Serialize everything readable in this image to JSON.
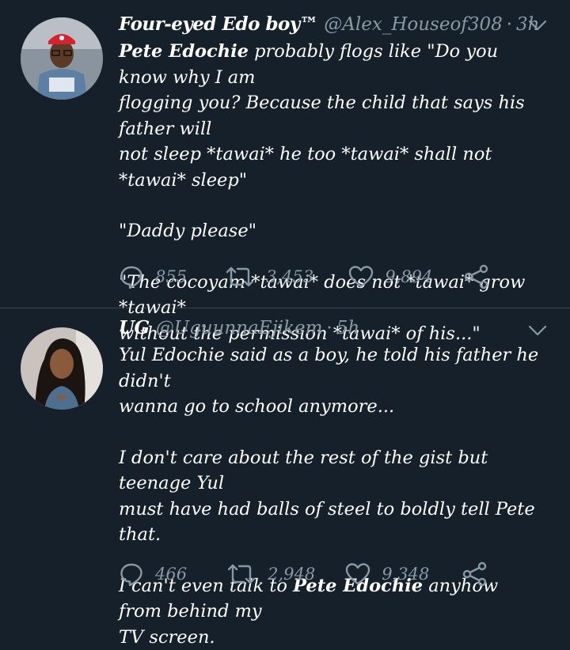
{
  "tweets": [
    {
      "name": "Four-eyed Edo boy™",
      "handle": "@Alex_Houseof308",
      "time": "3h",
      "lines": [
        [
          {
            "b": "Pete Edochie"
          },
          {
            "t": " probably flogs like \"Do you know why I am"
          }
        ],
        [
          {
            "t": "flogging you? Because the child that says his father will"
          }
        ],
        [
          {
            "t": "not sleep *tawai* he too *tawai* shall not *tawai* sleep\""
          }
        ],
        null,
        [
          {
            "t": "\"Daddy please\""
          }
        ],
        null,
        [
          {
            "t": "\"The cocoyam *tawai* does not *tawai* grow *tawai*"
          }
        ],
        [
          {
            "t": "without the permission *tawai* of his...\""
          }
        ]
      ],
      "replies": "855",
      "retweets": "3,453",
      "likes": "9,894"
    },
    {
      "name": "UG",
      "handle": "@UguunnaEjikem",
      "time": "5h",
      "lines": [
        [
          {
            "t": "Yul Edochie said as a boy, he told his father he didn't"
          }
        ],
        [
          {
            "t": "wanna go to school anymore..."
          }
        ],
        null,
        [
          {
            "t": "I don't care about the rest of the gist but teenage Yul"
          }
        ],
        [
          {
            "t": "must have had balls of steel to boldly tell Pete that."
          }
        ],
        null,
        [
          {
            "t": "I can't even talk to "
          },
          {
            "b": "Pete Edochie"
          },
          {
            "t": " anyhow from behind my"
          }
        ],
        [
          {
            "t": "TV screen."
          }
        ]
      ],
      "replies": "466",
      "retweets": "2,948",
      "likes": "9,348"
    }
  ],
  "colors": {
    "background": "#15202b",
    "text": "#ffffff",
    "muted": "#8899a6",
    "divider": "#38444d"
  },
  "icons": [
    "reply-icon",
    "retweet-icon",
    "like-icon",
    "share-icon",
    "chevron-down-icon"
  ]
}
